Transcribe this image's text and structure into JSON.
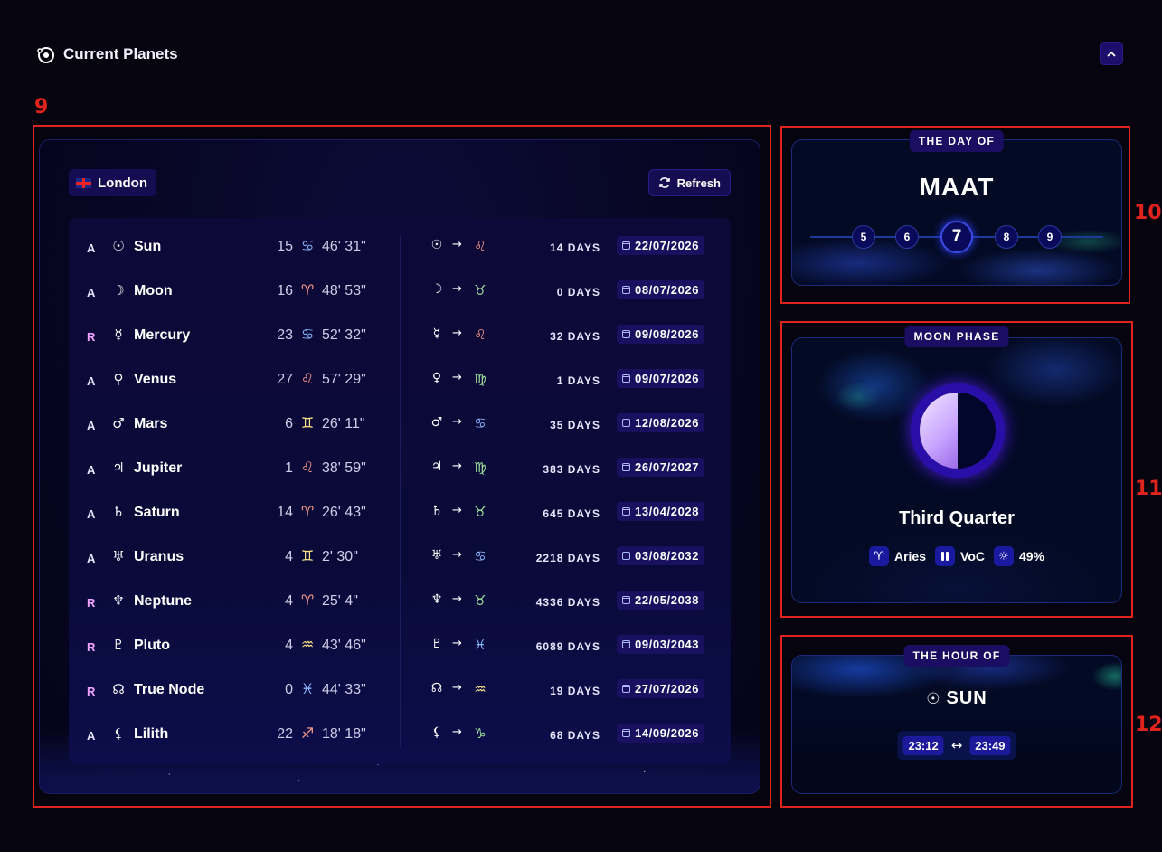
{
  "header": {
    "title": "Current Planets",
    "collapse_icon": "chevron-up-icon"
  },
  "annotations": [
    "9",
    "10",
    "11",
    "12"
  ],
  "planets_panel": {
    "location": "London",
    "refresh_label": "Refresh",
    "rows": [
      {
        "motion": "A",
        "glyph": "☉",
        "name": "Sun",
        "degree": "15",
        "sign": "♋",
        "sign_el": "water",
        "minutes": "46' 31\"",
        "target_sign": "♌",
        "target_el": "fire",
        "days": "14 DAYS",
        "date": "22/07/2026"
      },
      {
        "motion": "A",
        "glyph": "☽",
        "name": "Moon",
        "degree": "16",
        "sign": "♈",
        "sign_el": "fire",
        "minutes": "48' 53\"",
        "target_sign": "♉",
        "target_el": "earth",
        "days": "0 DAYS",
        "date": "08/07/2026"
      },
      {
        "motion": "R",
        "glyph": "☿",
        "name": "Mercury",
        "degree": "23",
        "sign": "♋",
        "sign_el": "water",
        "minutes": "52' 32\"",
        "target_sign": "♌",
        "target_el": "fire",
        "days": "32 DAYS",
        "date": "09/08/2026"
      },
      {
        "motion": "A",
        "glyph": "♀",
        "name": "Venus",
        "degree": "27",
        "sign": "♌",
        "sign_el": "fire",
        "minutes": "57' 29\"",
        "target_sign": "♍",
        "target_el": "earth",
        "days": "1 DAYS",
        "date": "09/07/2026"
      },
      {
        "motion": "A",
        "glyph": "♂",
        "name": "Mars",
        "degree": "6",
        "sign": "♊",
        "sign_el": "air",
        "minutes": "26' 11\"",
        "target_sign": "♋",
        "target_el": "water",
        "days": "35 DAYS",
        "date": "12/08/2026"
      },
      {
        "motion": "A",
        "glyph": "♃",
        "name": "Jupiter",
        "degree": "1",
        "sign": "♌",
        "sign_el": "fire",
        "minutes": "38' 59\"",
        "target_sign": "♍",
        "target_el": "earth",
        "days": "383 DAYS",
        "date": "26/07/2027"
      },
      {
        "motion": "A",
        "glyph": "♄",
        "name": "Saturn",
        "degree": "14",
        "sign": "♈",
        "sign_el": "fire",
        "minutes": "26' 43\"",
        "target_sign": "♉",
        "target_el": "earth",
        "days": "645 DAYS",
        "date": "13/04/2028"
      },
      {
        "motion": "A",
        "glyph": "♅",
        "name": "Uranus",
        "degree": "4",
        "sign": "♊",
        "sign_el": "air",
        "minutes": "2' 30\"",
        "target_sign": "♋",
        "target_el": "water",
        "days": "2218 DAYS",
        "date": "03/08/2032"
      },
      {
        "motion": "R",
        "glyph": "♆",
        "name": "Neptune",
        "degree": "4",
        "sign": "♈",
        "sign_el": "fire",
        "minutes": "25' 4\"",
        "target_sign": "♉",
        "target_el": "earth",
        "days": "4336 DAYS",
        "date": "22/05/2038"
      },
      {
        "motion": "R",
        "glyph": "♇",
        "name": "Pluto",
        "degree": "4",
        "sign": "♒",
        "sign_el": "air",
        "minutes": "43' 46\"",
        "target_sign": "♓",
        "target_el": "water",
        "days": "6089 DAYS",
        "date": "09/03/2043"
      },
      {
        "motion": "R",
        "glyph": "☊",
        "name": "True Node",
        "degree": "0",
        "sign": "♓",
        "sign_el": "water",
        "minutes": "44' 33\"",
        "target_sign": "♒",
        "target_el": "air",
        "days": "19 DAYS",
        "date": "27/07/2026"
      },
      {
        "motion": "A",
        "glyph": "⚸",
        "name": "Lilith",
        "degree": "22",
        "sign": "♐",
        "sign_el": "fire",
        "minutes": "18' 18\"",
        "target_sign": "♑",
        "target_el": "earth",
        "days": "68 DAYS",
        "date": "14/09/2026"
      }
    ]
  },
  "day_card": {
    "label": "THE DAY OF",
    "deity": "MAAT",
    "days": [
      "5",
      "6",
      "7",
      "8",
      "9"
    ],
    "active_day": "7"
  },
  "moon_card": {
    "label": "MOON PHASE",
    "phase": "Third Quarter",
    "illumination": 0.49,
    "badges": [
      {
        "icon": "aries-icon",
        "glyph": "♈",
        "text": "Aries"
      },
      {
        "icon": "pause-icon",
        "glyph": "⏸",
        "text": "VoC"
      },
      {
        "icon": "sun-brightness-icon",
        "glyph": "☼",
        "text": "49%"
      }
    ]
  },
  "hour_card": {
    "label": "THE HOUR OF",
    "glyph": "☉",
    "planet": "SUN",
    "start": "23:12",
    "arrow": "↔",
    "end": "23:49"
  },
  "colors": {
    "accent": "#1c0e6a",
    "annotation": "#e0231c",
    "fire": "#ff9b8a",
    "earth": "#9fe6a0",
    "air": "#ffe58a",
    "water": "#8ab8ff",
    "retrograde": "#f0a0ff"
  }
}
